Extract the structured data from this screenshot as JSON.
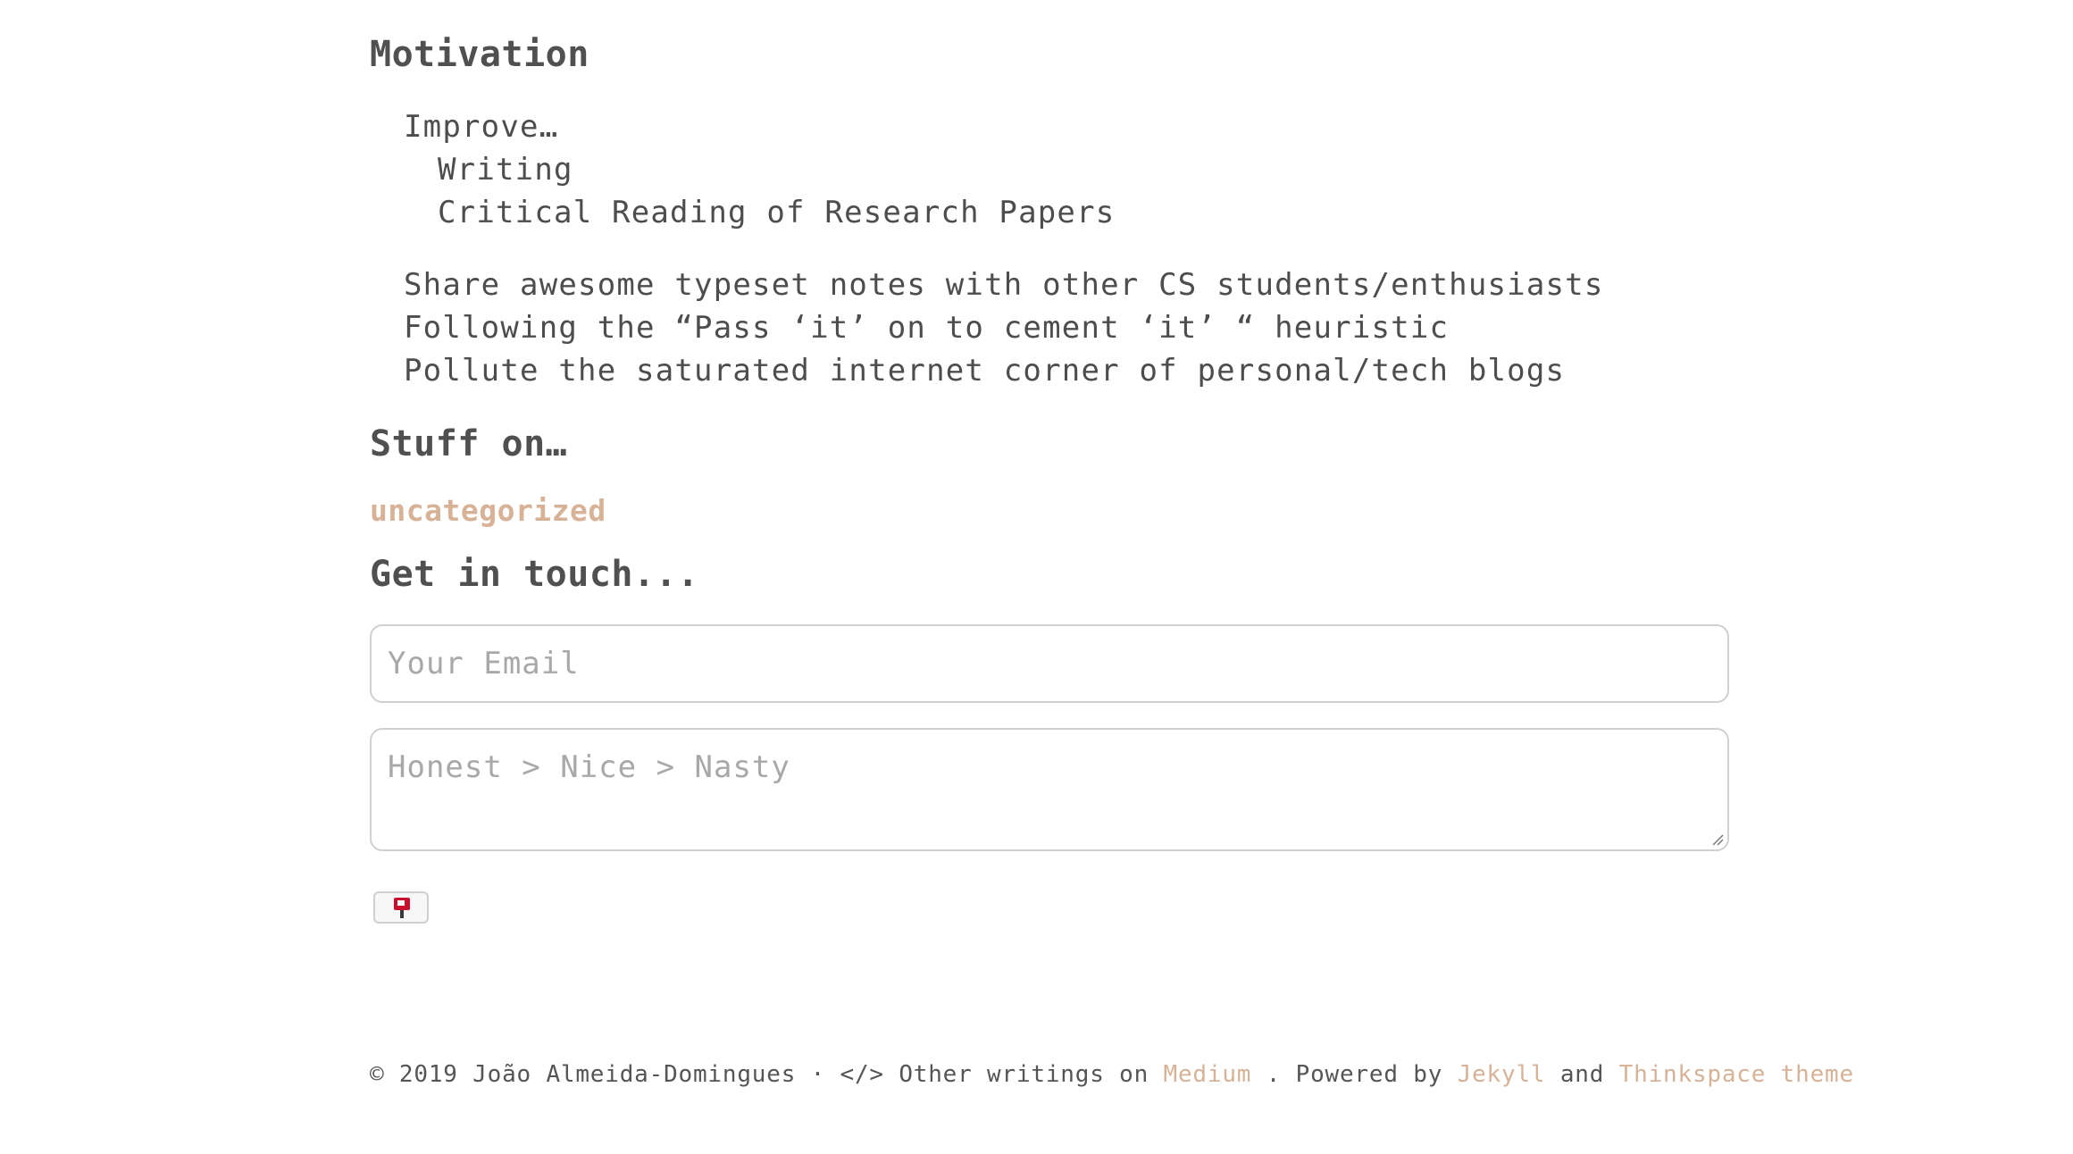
{
  "motivation": {
    "title": "Motivation",
    "improve_label": "Improve…",
    "improve_items": [
      "Writing",
      "Critical Reading of Research Papers"
    ],
    "bullets": [
      "Share awesome typeset notes with other CS students/enthusiasts",
      "Following the “Pass ‘it’ on to cement ‘it’ “ heuristic",
      "Pollute the saturated internet corner of personal/tech blogs"
    ]
  },
  "stuff": {
    "title": "Stuff on…",
    "categories": [
      "uncategorized"
    ]
  },
  "contact": {
    "title": "Get in touch...",
    "email_placeholder": "Your Email",
    "message_placeholder": "Honest > Nice > Nasty",
    "send_icon": "mailbox-icon"
  },
  "footer": {
    "copyright": "© 2019 João Almeida-Domingues · </> Other writings on",
    "medium_link": "Medium",
    "powered_by": ". Powered by",
    "jekyll_link": "Jekyll",
    "and": "and",
    "theme_link": "Thinkspace theme"
  },
  "colors": {
    "link": "#d7b297",
    "text": "#4a4a4a",
    "icon_red": "#c8102e"
  }
}
